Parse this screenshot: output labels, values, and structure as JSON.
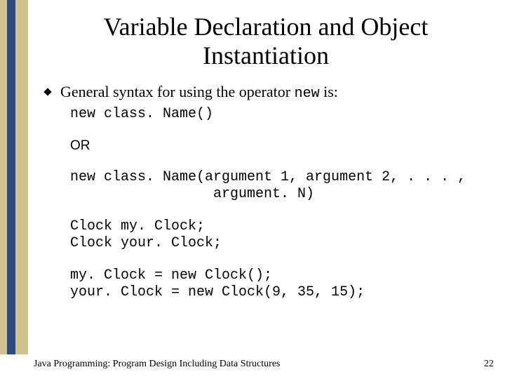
{
  "title": "Variable Declaration and Object Instantiation",
  "bullet": {
    "prefix": "General syntax for using the operator ",
    "kw": "new",
    "suffix": " is:"
  },
  "code1": "new class. Name()",
  "or": "OR",
  "code2": "new class. Name(argument 1, argument 2, . . . ,\n                 argument. N)",
  "code3": "Clock my. Clock;\nClock your. Clock;",
  "code4": "my. Clock = new Clock();\nyour. Clock = new Clock(9, 35, 15);",
  "footer": {
    "left": "Java Programming: Program Design Including Data Structures",
    "page": "22"
  }
}
